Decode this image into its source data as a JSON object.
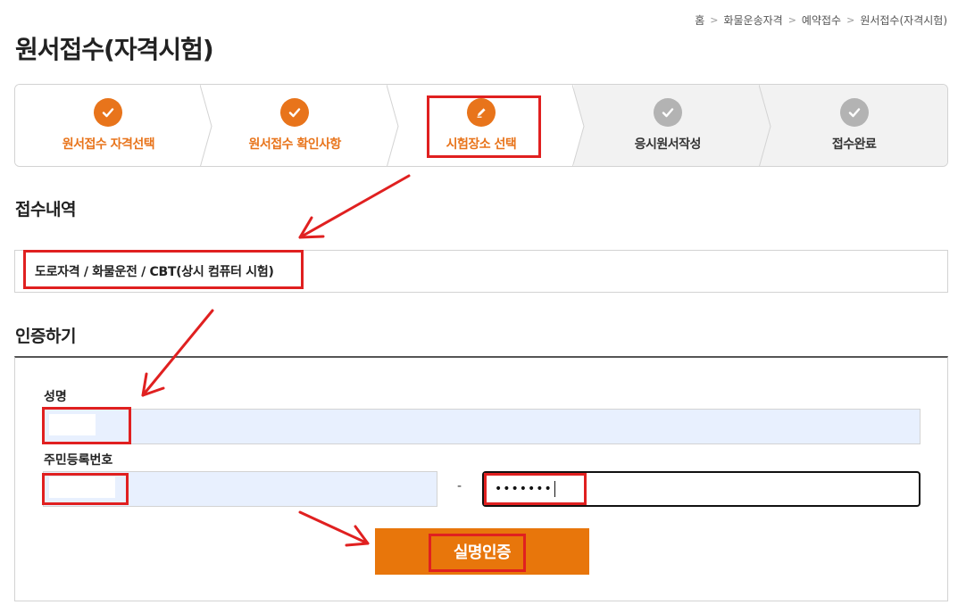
{
  "breadcrumb": [
    "홈",
    "화물운송자격",
    "예약접수",
    "원서접수(자격시험)"
  ],
  "page_title": "원서접수(자격시험)",
  "steps": [
    {
      "label": "원서접수 자격선택",
      "status": "done",
      "icon": "check-icon"
    },
    {
      "label": "원서접수 확인사항",
      "status": "done",
      "icon": "check-icon"
    },
    {
      "label": "시험장소 선택",
      "status": "current",
      "icon": "pencil-icon"
    },
    {
      "label": "응시원서작성",
      "status": "pending",
      "icon": "check-icon"
    },
    {
      "label": "접수완료",
      "status": "pending",
      "icon": "check-icon"
    }
  ],
  "receipt": {
    "title": "접수내역",
    "value": "도로자격 / 화물운전 / CBT(상시 컴퓨터 시험)"
  },
  "auth": {
    "title": "인증하기",
    "name_label": "성명",
    "rrn_label": "주민등록번호",
    "rrn_separator": "-",
    "rrn_back_value": "•••••••",
    "verify_label": "실명인증"
  },
  "colors": {
    "accent": "#e8741b",
    "pending": "#b3b3b3",
    "highlight": "#e02020",
    "input_fill": "#e8f0fe"
  }
}
